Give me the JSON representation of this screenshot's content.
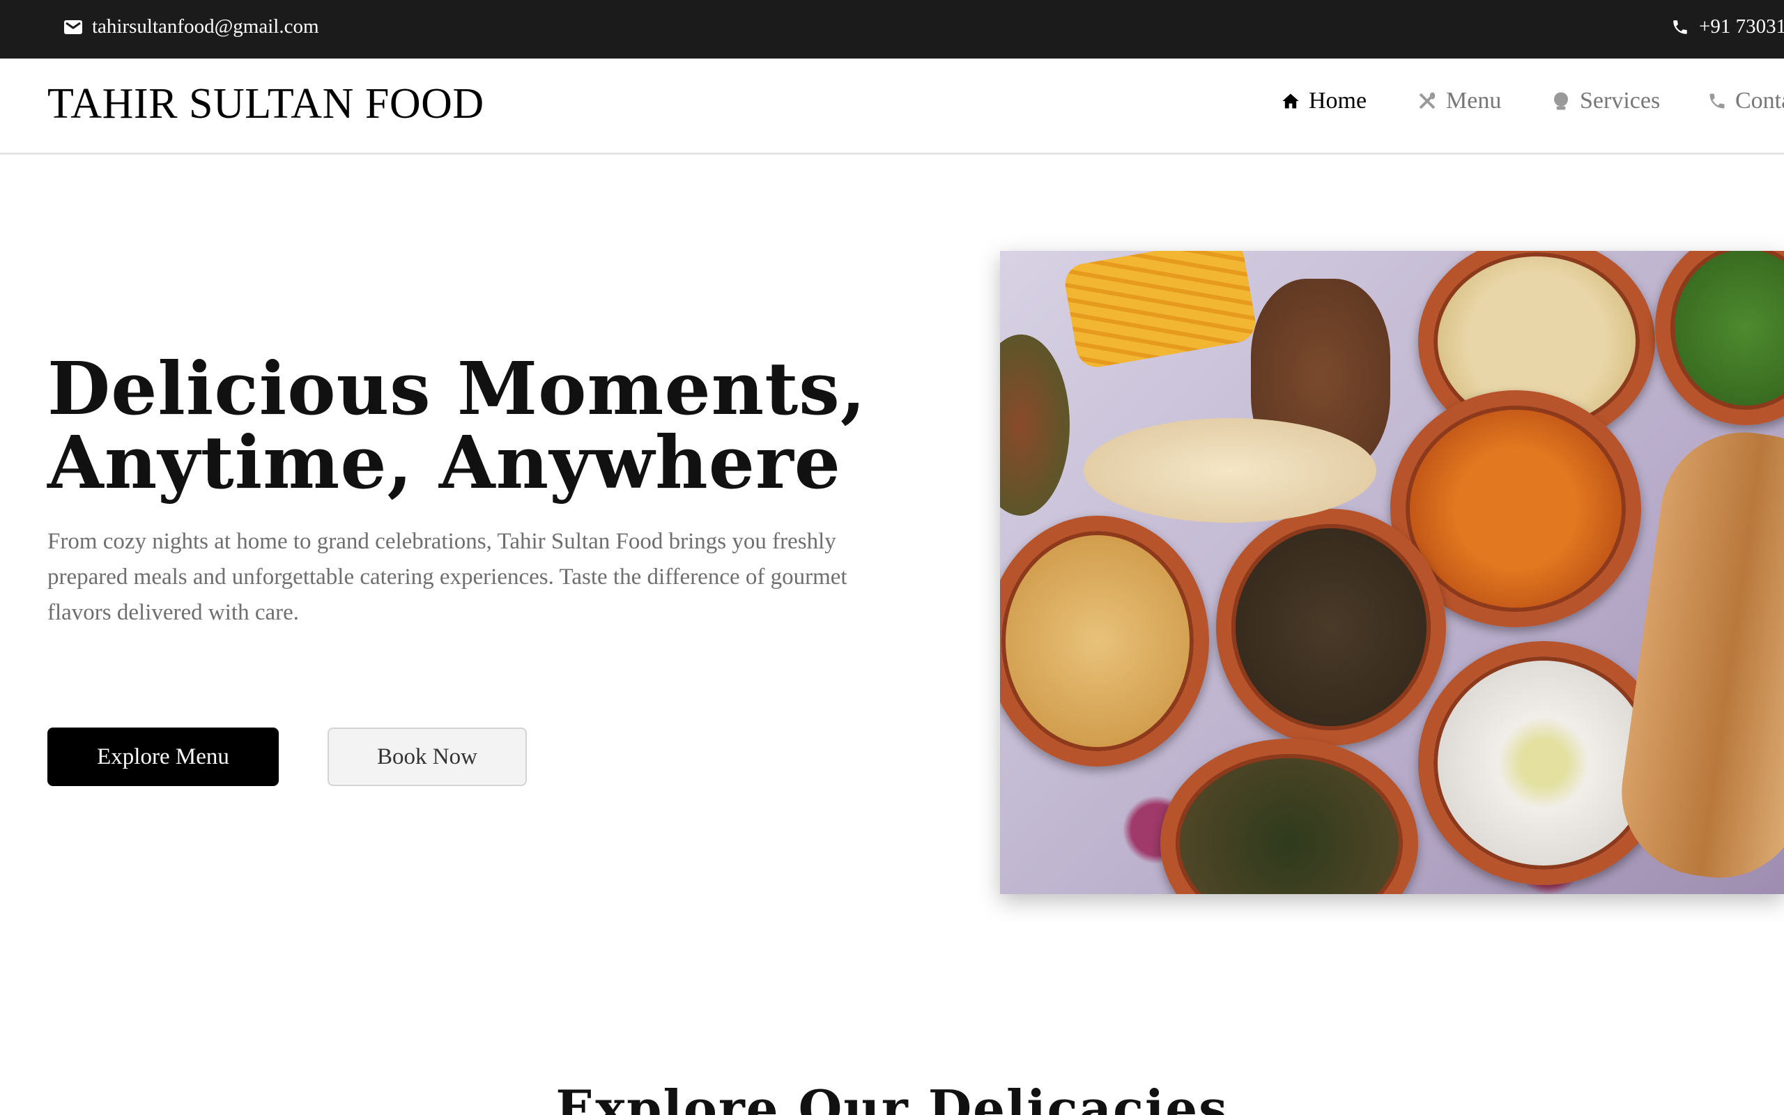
{
  "topbar": {
    "email": "tahirsultanfood@gmail.com",
    "phone": "+91 73031"
  },
  "header": {
    "logo": "TAHIR SULTAN FOOD",
    "nav": [
      {
        "label": "Home",
        "icon": "home-icon",
        "active": true
      },
      {
        "label": "Menu",
        "icon": "utensils-icon"
      },
      {
        "label": "Services",
        "icon": "chef-hat-icon"
      },
      {
        "label": "Contact",
        "icon": "phone-icon"
      }
    ]
  },
  "hero": {
    "title_line1": "Delicious Moments,",
    "title_line2": "Anytime, Anywhere",
    "description": "From cozy nights at home to grand celebrations, Tahir Sultan Food brings you freshly prepared meals and unforgettable catering experiences. Taste the difference of gourmet flavors delivered with care.",
    "primary_button": "Explore Menu",
    "secondary_button": "Book Now"
  },
  "section": {
    "title": "Explore Our Delicacies"
  }
}
